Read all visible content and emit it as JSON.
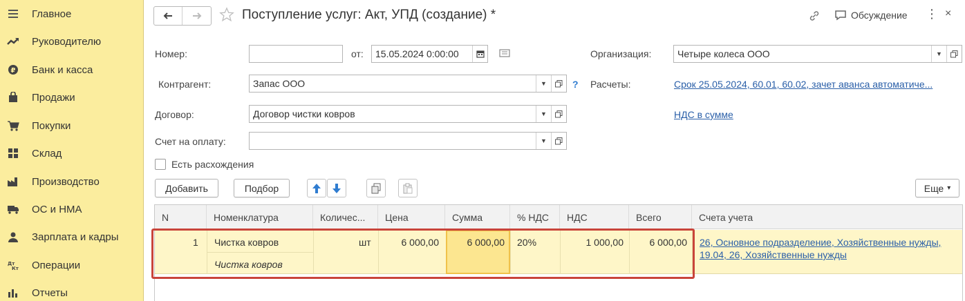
{
  "sidebar": {
    "items": [
      {
        "label": "Главное",
        "icon": "menu-icon"
      },
      {
        "label": "Руководителю",
        "icon": "trend-icon"
      },
      {
        "label": "Банк и касса",
        "icon": "coin-icon"
      },
      {
        "label": "Продажи",
        "icon": "bag-icon"
      },
      {
        "label": "Покупки",
        "icon": "cart-icon"
      },
      {
        "label": "Склад",
        "icon": "warehouse-icon"
      },
      {
        "label": "Производство",
        "icon": "factory-icon"
      },
      {
        "label": "ОС и НМА",
        "icon": "truck-icon"
      },
      {
        "label": "Зарплата и кадры",
        "icon": "person-icon"
      },
      {
        "label": "Операции",
        "icon": "dt-kt-icon"
      },
      {
        "label": "Отчеты",
        "icon": "bar-chart-icon"
      }
    ]
  },
  "header": {
    "title": "Поступление услуг: Акт, УПД (создание) *",
    "discussion_label": "Обсуждение",
    "more_glyph": "⋮",
    "close_glyph": "×"
  },
  "form": {
    "number_label": "Номер:",
    "number_value": "",
    "from_label": "от:",
    "date_value": "15.05.2024  0:00:00",
    "org_label": "Организация:",
    "org_value": "Четыре колеса ООО",
    "counterparty_label": "Контрагент:",
    "counterparty_value": "Запас ООО",
    "help_glyph": "?",
    "settlements_label": "Расчеты:",
    "settlements_link": "Срок 25.05.2024, 60.01, 60.02, зачет аванса автоматиче...",
    "contract_label": "Договор:",
    "contract_value": "Договор чистки ковров",
    "vat_link": "НДС в сумме",
    "invoice_label": "Счет на оплату:",
    "invoice_value": "",
    "discrepancy_label": "Есть расхождения",
    "discrepancy_checked": false
  },
  "toolbar": {
    "add_label": "Добавить",
    "pick_label": "Подбор",
    "more_label": "Еще",
    "more_arrow": "▾"
  },
  "table": {
    "columns": [
      "N",
      "Номенклатура",
      "Количес...",
      "Цена",
      "Сумма",
      "% НДС",
      "НДС",
      "Всего",
      "Счета учета"
    ],
    "rows": [
      {
        "n": "1",
        "item": "Чистка ковров",
        "item_content": "Чистка ковров",
        "quantity": "",
        "unit": "шт",
        "price": "6 000,00",
        "sum": "6 000,00",
        "vat_rate": "20%",
        "vat": "1 000,00",
        "total": "6 000,00",
        "accounts_line1": "26, Основное подразделение, Хозяйственные нужды,",
        "accounts_line2": "19.04, 26, Хозяйственные нужды"
      }
    ]
  },
  "colors": {
    "sidebar_bg": "#fbed9e",
    "row_selected": "#fef6c8",
    "active_cell": "#fce690",
    "link": "#2a5fa8",
    "highlight_frame": "#c9443a",
    "arrow_blue": "#2f7cd0"
  }
}
